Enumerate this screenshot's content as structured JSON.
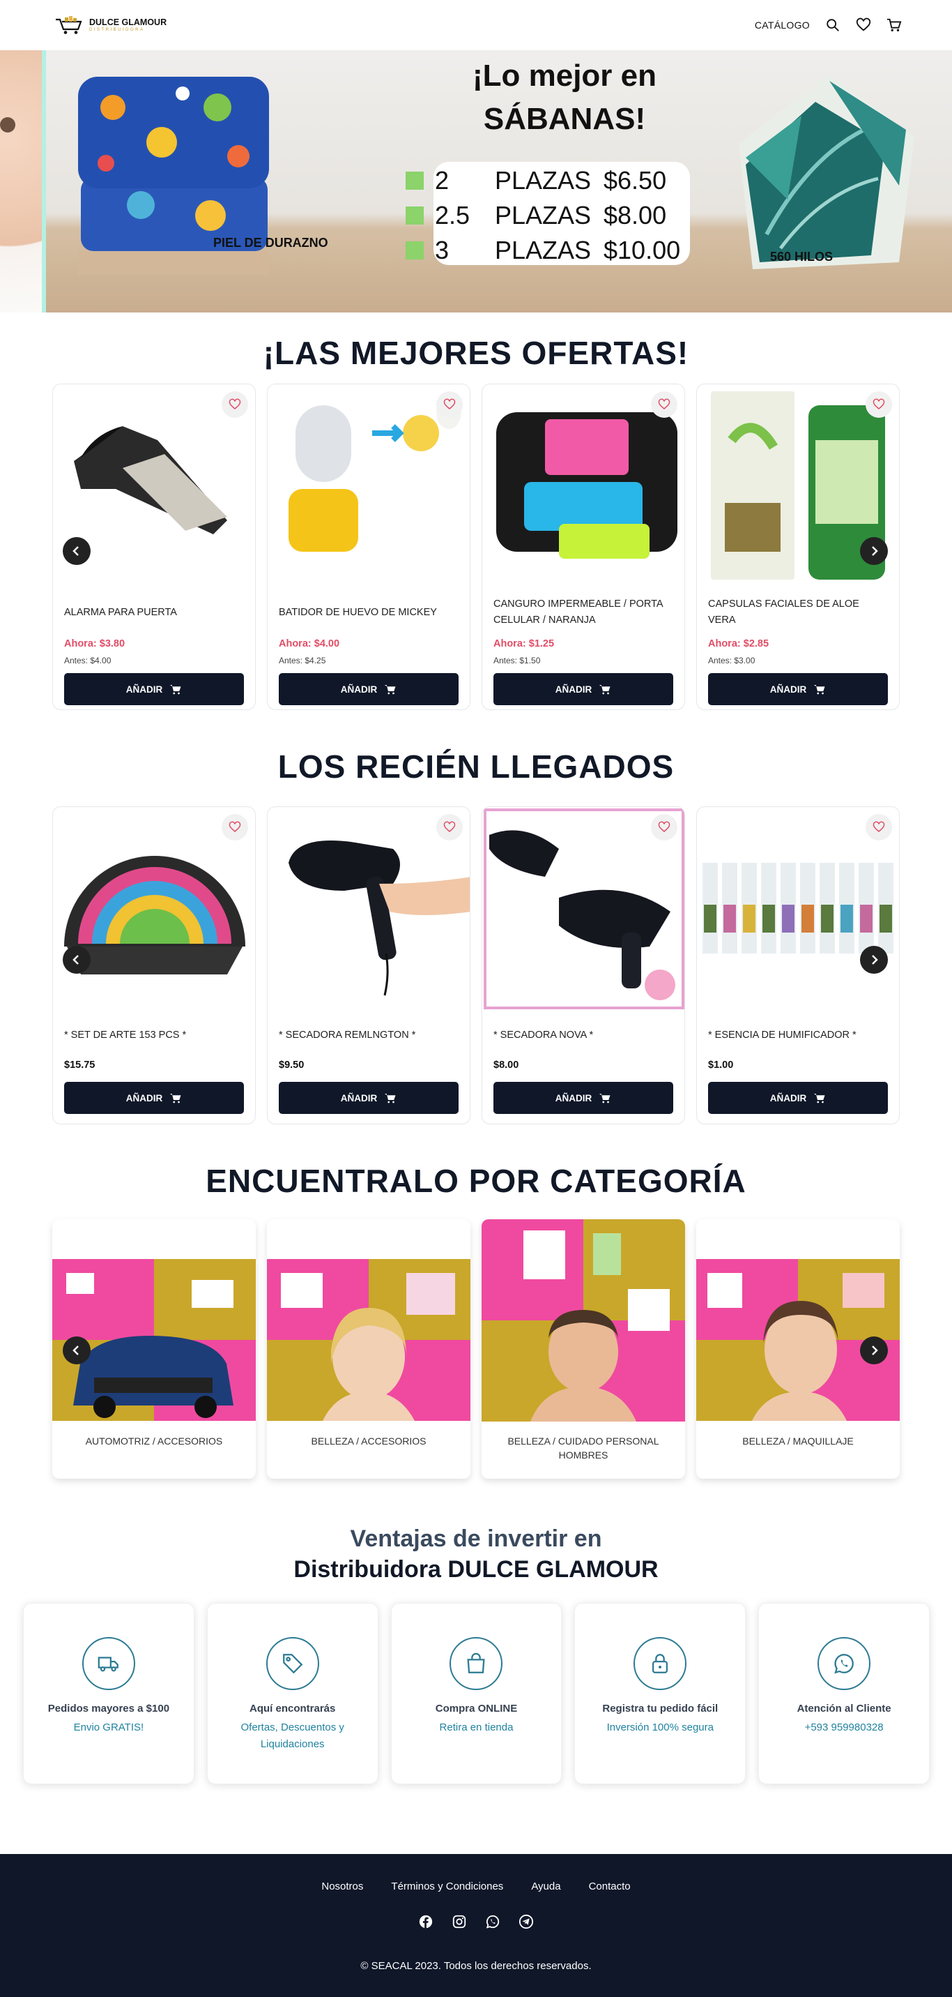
{
  "header": {
    "logo_title": "DULCE GLAMOUR",
    "logo_sub": "DISTRIBUIDORA",
    "nav_catalog": "CATÁLOGO"
  },
  "hero": {
    "title_line1": "¡Lo mejor en",
    "title_line2": "SÁBANAS!",
    "rows": [
      {
        "n": "2",
        "w": "PLAZAS",
        "p": "$6.50"
      },
      {
        "n": "2.5",
        "w": "PLAZAS",
        "p": "$8.00"
      },
      {
        "n": "3",
        "w": "PLAZAS",
        "p": "$10.00"
      }
    ],
    "label_left": "PIEL DE DURAZNO",
    "label_right": "560 HILOS"
  },
  "offers": {
    "title": "¡LAS MEJORES OFERTAS!",
    "add_label": "AÑADIR",
    "items": [
      {
        "name": "ALARMA PARA PUERTA",
        "now": "Ahora: $3.80",
        "before": "Antes: $4.00"
      },
      {
        "name": "BATIDOR DE HUEVO DE MICKEY",
        "now": "Ahora: $4.00",
        "before": "Antes: $4.25"
      },
      {
        "name": "CANGURO IMPERMEABLE / PORTA CELULAR / NARANJA",
        "now": "Ahora: $1.25",
        "before": "Antes: $1.50"
      },
      {
        "name": "CAPSULAS FACIALES DE ALOE VERA",
        "now": "Ahora: $2.85",
        "before": "Antes: $3.00"
      }
    ]
  },
  "arrivals": {
    "title": "LOS RECIÉN LLEGADOS",
    "add_label": "AÑADIR",
    "items": [
      {
        "name": "* SET DE ARTE 153 PCS *",
        "price": "$15.75"
      },
      {
        "name": "* SECADORA REMLNGTON *",
        "price": "$9.50"
      },
      {
        "name": "* SECADORA NOVA *",
        "price": "$8.00"
      },
      {
        "name": "* ESENCIA DE HUMIFICADOR *",
        "price": "$1.00"
      }
    ]
  },
  "categories": {
    "title": "ENCUENTRALO POR CATEGORÍA",
    "items": [
      {
        "label": "AUTOMOTRIZ / ACCESORIOS"
      },
      {
        "label": "BELLEZA / ACCESORIOS"
      },
      {
        "label": "BELLEZA / CUIDADO PERSONAL HOMBRES"
      },
      {
        "label": "BELLEZA / MAQUILLAJE"
      }
    ]
  },
  "advantages": {
    "title_line1": "Ventajas de invertir en",
    "title_line2": "Distribuidora DULCE GLAMOUR",
    "items": [
      {
        "icon": "truck-icon",
        "title": "Pedidos mayores a $100",
        "text": "Envio GRATIS!"
      },
      {
        "icon": "tag-icon",
        "title": "Aquí encontrarás",
        "text": "Ofertas, Descuentos y Liquidaciones"
      },
      {
        "icon": "shopping-bag-icon",
        "title": "Compra ONLINE",
        "text": "Retira en tienda"
      },
      {
        "icon": "lock-icon",
        "title": "Registra tu pedido fácil",
        "text": "Inversión 100% segura"
      },
      {
        "icon": "whatsapp-icon",
        "title": "Atención al Cliente",
        "text": "+593 959980328"
      }
    ]
  },
  "footer": {
    "links": [
      "Nosotros",
      "Términos y Condiciones",
      "Ayuda",
      "Contacto"
    ],
    "copyright": "© SEACAL 2023. Todos los derechos reservados."
  },
  "colors": {
    "navy": "#0f1729",
    "sale_red": "#e14d66",
    "teal": "#21839f",
    "mustard": "#c9a72a",
    "magenta": "#ef4aa0"
  }
}
